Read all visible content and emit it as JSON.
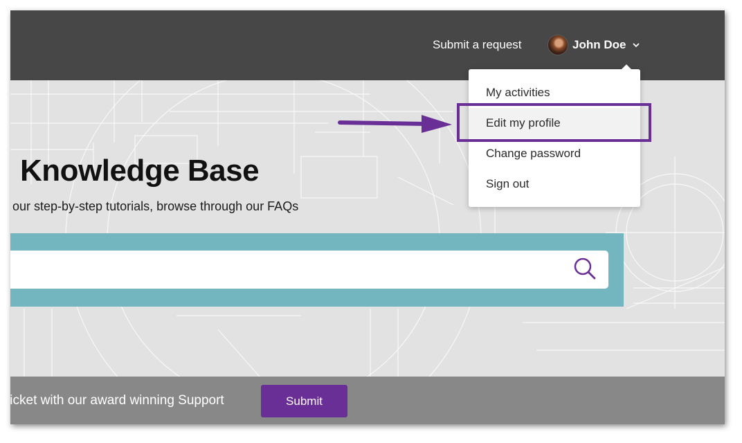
{
  "header": {
    "submit_request_label": "Submit a request",
    "user": {
      "name": "John Doe"
    }
  },
  "dropdown": {
    "items": [
      {
        "label": "My activities"
      },
      {
        "label": "Edit my profile",
        "active": true
      },
      {
        "label": "Change password"
      },
      {
        "label": "Sign out"
      }
    ]
  },
  "hero": {
    "title": "Knowledge Base",
    "subtitle": "our step-by-step tutorials, browse through our FAQs",
    "search": {
      "value": "",
      "placeholder": ""
    }
  },
  "footer": {
    "text": "ticket with our award winning Support",
    "button_label": "Submit"
  },
  "colors": {
    "header_bg": "#474747",
    "accent_purple": "#6a2f97",
    "search_band": "#74b6bf",
    "footer_bg": "#808080"
  },
  "icons": {
    "search": "magnifier",
    "user_menu_toggle": "chevron-down",
    "annotation": "arrow-right"
  }
}
